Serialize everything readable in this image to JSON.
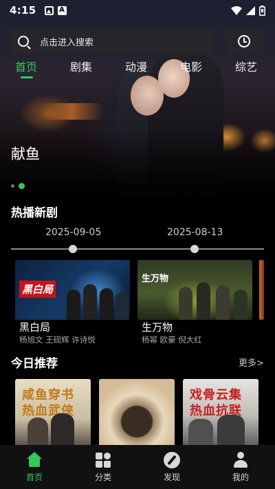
{
  "status_bar": {
    "time": "4:15",
    "icons": [
      "image-icon",
      "a-icon",
      "wifi-icon",
      "signal-icon",
      "battery-icon"
    ]
  },
  "search": {
    "placeholder": "点击进入搜索"
  },
  "tabs": [
    {
      "label": "首页",
      "active": true
    },
    {
      "label": "剧集",
      "active": false
    },
    {
      "label": "动漫",
      "active": false
    },
    {
      "label": "电影",
      "active": false
    },
    {
      "label": "综艺",
      "active": false
    }
  ],
  "hero": {
    "title": "献鱼",
    "page_count": 2,
    "current_page": 2
  },
  "hot_new": {
    "title": "热播新剧",
    "dates": [
      "2025-09-05",
      "2025-08-13"
    ],
    "shows": [
      {
        "name": "黑白局",
        "cast": "杨旭文 王砚辉 许诗悦",
        "poster_text": "黑白局"
      },
      {
        "name": "生万物",
        "cast": "杨幂 欧豪 倪大红",
        "poster_text": "生万物"
      }
    ]
  },
  "today_picks": {
    "title": "今日推荐",
    "more_label": "更多>",
    "posters": [
      {
        "text": "咸鱼穿书\n热血武侠"
      },
      {
        "text": ""
      },
      {
        "text": "戏骨云集\n热血抗联"
      }
    ]
  },
  "bottom_nav": [
    {
      "label": "首页",
      "icon": "home-icon",
      "active": true
    },
    {
      "label": "分类",
      "icon": "category-icon",
      "active": false
    },
    {
      "label": "发现",
      "icon": "compass-icon",
      "active": false
    },
    {
      "label": "我的",
      "icon": "user-icon",
      "active": false
    }
  ],
  "colors": {
    "accent": "#35c85a",
    "background": "#000000",
    "nav_background": "#111111"
  }
}
